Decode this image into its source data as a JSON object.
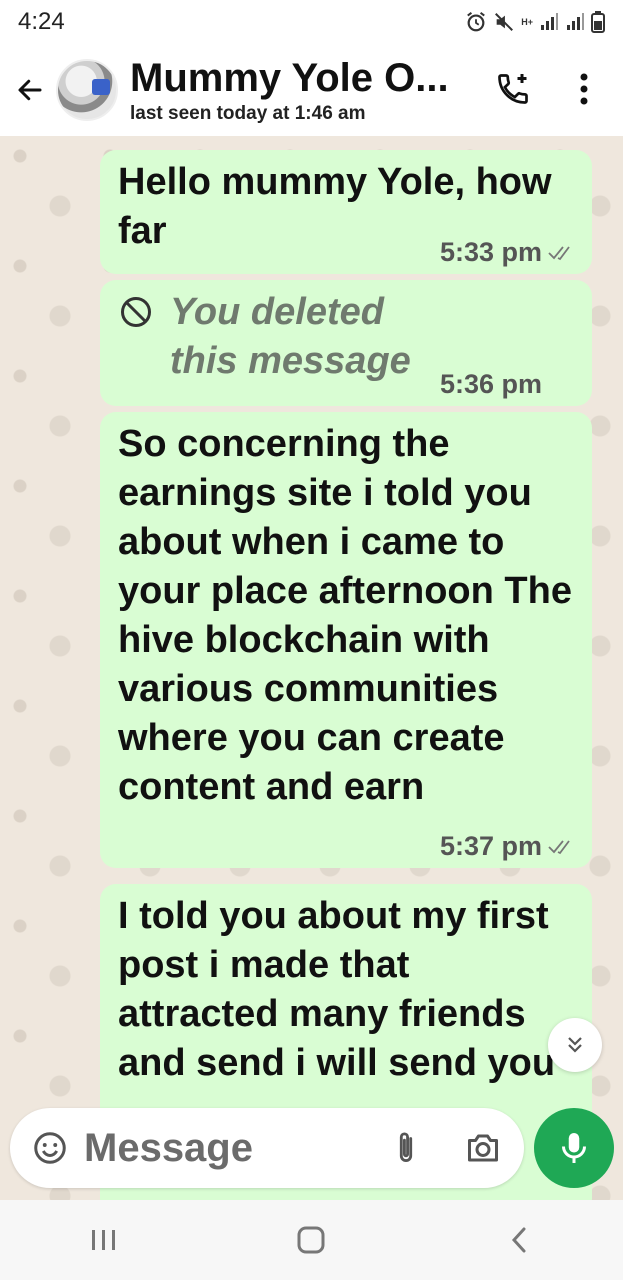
{
  "status_bar": {
    "time": "4:24",
    "network_label": "H+",
    "icons": [
      "alarm-icon",
      "mute-icon",
      "signal-icon",
      "signal-icon",
      "battery-icon"
    ]
  },
  "header": {
    "title": "Mummy Yole O...",
    "subtitle": "last seen today at 1:46 am",
    "icons": [
      "back-arrow-icon",
      "add-call-icon",
      "more-vert-icon"
    ]
  },
  "messages": [
    {
      "type": "text",
      "text": "Hello  mummy Yole, how far",
      "time": "5:33 pm",
      "status": "delivered-double-tick"
    },
    {
      "type": "deleted",
      "text": "You deleted this message",
      "time": "5:36 pm"
    },
    {
      "type": "text",
      "text": "So concerning the earnings site i told you about when i came to your place afternoon The hive blockchain with various communities where you can create content and earn",
      "time": "5:37 pm",
      "status": "delivered-double-tick"
    },
    {
      "type": "text",
      "text": "I told you about my first post i made that attracted many friends and send i will send you"
    }
  ],
  "input": {
    "placeholder": "Message",
    "icons": [
      "emoji-icon",
      "attach-icon",
      "camera-icon",
      "mic-icon"
    ]
  },
  "colors": {
    "outgoing_bubble": "#d9fdd3",
    "chat_background": "#efe7dd",
    "mic_button": "#1fa855"
  }
}
